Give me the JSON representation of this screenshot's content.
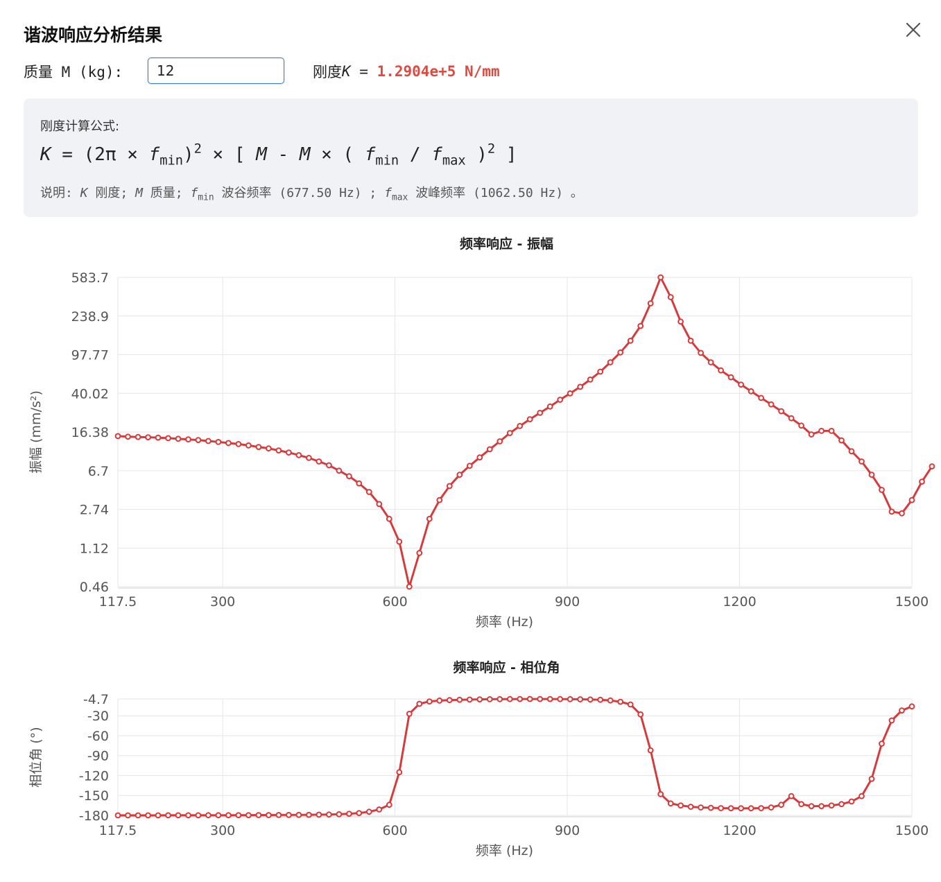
{
  "dialog": {
    "title": "谐波响应分析结果"
  },
  "mass": {
    "label": "质量 M (kg):",
    "value": "12"
  },
  "stiffness": {
    "label": "刚度",
    "symbol": "K",
    "equals": " = ",
    "value": "1.2904e+5 N/mm"
  },
  "formula": {
    "label": "刚度计算公式:",
    "note_prefix": "说明:",
    "note_k": "刚度;",
    "note_m": "质量;",
    "note_fmin": "波谷频率 (677.50 Hz) ;",
    "note_fmax": "波峰频率 (1062.50 Hz) 。"
  },
  "colors": {
    "series": "#d63a3a",
    "accent": "#e0493f",
    "input_border": "#3a7bd5"
  },
  "amplitude_chart_data": {
    "type": "line",
    "title": "频率响应 - 振幅",
    "xlabel": "频率 (Hz)",
    "ylabel": "振幅 (mm/s²)",
    "xlim": [
      117.5,
      1500
    ],
    "x_ticks": [
      "117.5",
      "300",
      "600",
      "900",
      "1200",
      "1500"
    ],
    "y_scale": "log",
    "y_ticks": [
      "0.46",
      "1.12",
      "2.74",
      "6.7",
      "16.38",
      "40.02",
      "97.77",
      "238.9",
      "583.7"
    ],
    "ylim": [
      0.46,
      583.7
    ],
    "grid": true,
    "x_start": 117.5,
    "x_step": 17.5,
    "values": [
      14.9,
      14.7,
      14.6,
      14.5,
      14.4,
      14.2,
      14.0,
      13.8,
      13.6,
      13.3,
      13.0,
      12.7,
      12.4,
      12.0,
      11.6,
      11.2,
      10.7,
      10.2,
      9.6,
      9.0,
      8.3,
      7.6,
      6.7,
      5.9,
      5.0,
      4.1,
      3.1,
      2.2,
      1.3,
      0.46,
      1.0,
      2.2,
      3.4,
      4.7,
      6.1,
      7.5,
      9.1,
      11.0,
      13.2,
      16.0,
      18.8,
      22.0,
      25.5,
      29.5,
      34.5,
      40.0,
      46.5,
      55.0,
      66.0,
      82.0,
      103.0,
      135.0,
      190.0,
      320.0,
      583.7,
      370.0,
      210.0,
      135.0,
      102.0,
      82.0,
      68.0,
      58.0,
      49.0,
      42.0,
      36.0,
      31.0,
      26.5,
      22.5,
      19.0,
      15.5,
      16.8,
      16.8,
      13.5,
      10.5,
      8.3,
      6.1,
      4.3,
      2.6,
      2.5,
      3.4,
      5.2,
      7.4
    ]
  },
  "phase_chart_data": {
    "type": "line",
    "title": "频率响应 - 相位角",
    "xlabel": "频率 (Hz)",
    "ylabel": "相位角 (°)",
    "xlim": [
      117.5,
      1500
    ],
    "x_ticks": [
      "117.5",
      "300",
      "600",
      "900",
      "1200",
      "1500"
    ],
    "y_ticks": [
      "-4.7",
      "-30",
      "-60",
      "-90",
      "-120",
      "-150",
      "-180"
    ],
    "ylim": [
      -180,
      -4.7
    ],
    "grid": true,
    "x_start": 117.5,
    "x_step": 17.5,
    "values": [
      -179.9,
      -179.9,
      -179.9,
      -179.9,
      -179.9,
      -179.8,
      -179.8,
      -179.8,
      -179.8,
      -179.7,
      -179.7,
      -179.7,
      -179.6,
      -179.6,
      -179.5,
      -179.5,
      -179.4,
      -179.3,
      -179.2,
      -179.1,
      -178.9,
      -178.6,
      -178.2,
      -177.5,
      -176.5,
      -174.5,
      -171.0,
      -164.0,
      -115.0,
      -27.0,
      -12.0,
      -8.5,
      -7.2,
      -6.5,
      -6.0,
      -5.6,
      -5.3,
      -5.1,
      -5.0,
      -4.9,
      -4.8,
      -4.8,
      -4.8,
      -4.8,
      -4.9,
      -5.0,
      -5.2,
      -5.5,
      -6.0,
      -7.0,
      -9.0,
      -13.0,
      -28.0,
      -82.0,
      -148.0,
      -162.0,
      -165.0,
      -167.0,
      -168.0,
      -168.5,
      -169.0,
      -169.2,
      -169.3,
      -169.3,
      -169.0,
      -168.0,
      -164.0,
      -151.0,
      -163.0,
      -166.0,
      -166.0,
      -165.0,
      -163.0,
      -159.0,
      -151.0,
      -125.0,
      -72.0,
      -37.0,
      -22.0,
      -16.0
    ]
  }
}
